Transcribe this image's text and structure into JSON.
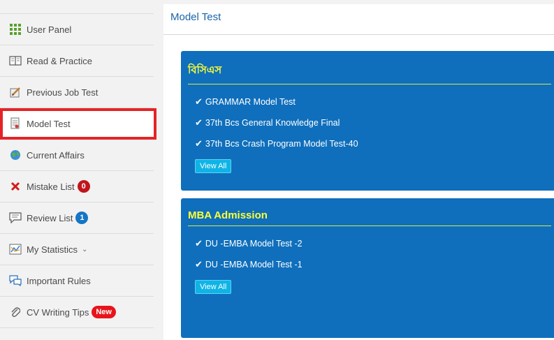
{
  "sidebar": {
    "items": [
      {
        "label": "User Panel",
        "icon": "grid-icon"
      },
      {
        "label": "Read & Practice",
        "icon": "book-icon"
      },
      {
        "label": "Previous Job Test",
        "icon": "pencil-icon"
      },
      {
        "label": "Model Test",
        "icon": "document-icon"
      },
      {
        "label": "Current Affairs",
        "icon": "globe-icon"
      },
      {
        "label": "Mistake List",
        "icon": "close-icon",
        "badge": "0"
      },
      {
        "label": "Review List",
        "icon": "comment-icon",
        "badge": "1"
      },
      {
        "label": "My Statistics",
        "icon": "chart-icon"
      },
      {
        "label": "Important Rules",
        "icon": "chat-icon"
      },
      {
        "label": "CV Writing Tips",
        "icon": "paperclip-icon",
        "badge": "New"
      }
    ]
  },
  "main": {
    "title": "Model Test",
    "cards": [
      {
        "title": "বিসিএস",
        "tests": [
          "GRAMMAR Model Test",
          "37th Bcs General Knowledge Final",
          "37th Bcs Crash Program Model Test-40"
        ],
        "button": "View All"
      },
      {
        "title": "MBA Admission",
        "tests": [
          "DU -EMBA Model Test -2",
          "DU -EMBA Model Test -1"
        ],
        "button": "View All"
      }
    ]
  },
  "colors": {
    "accent": "#0f6fbc",
    "highlight": "#e52327",
    "title_yellow": "#ffff36"
  }
}
